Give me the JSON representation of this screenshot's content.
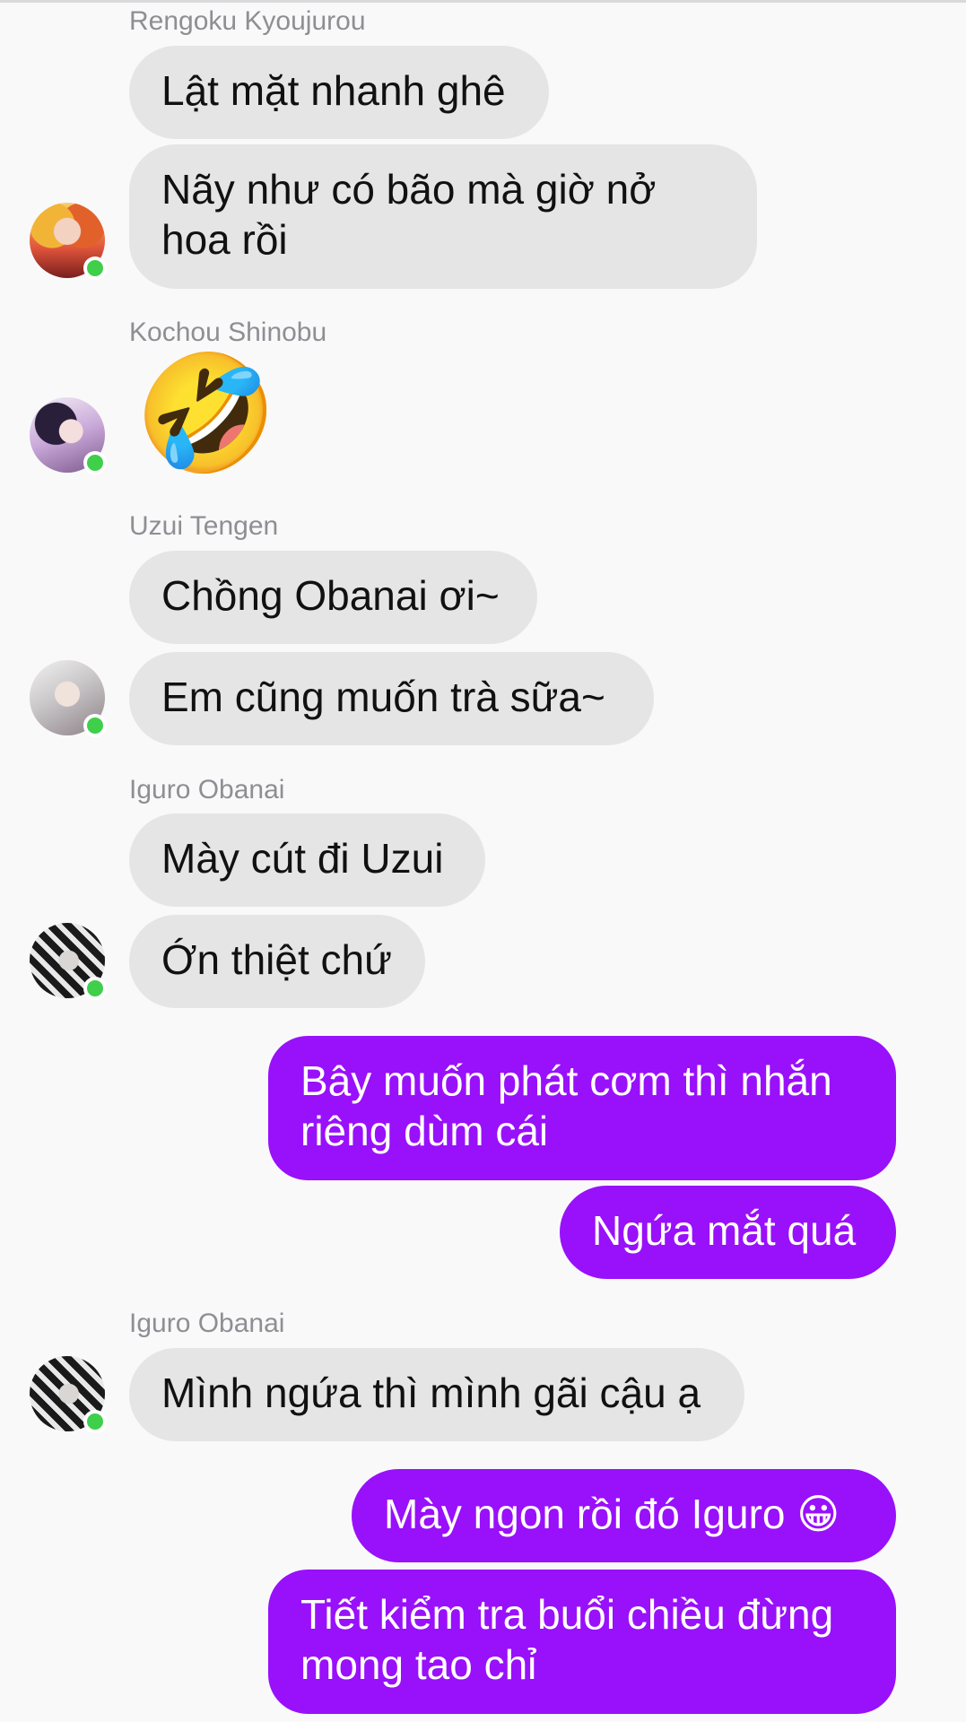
{
  "messages": [
    {
      "sender": "Rengoku Kyoujurou",
      "bubbles": [
        "Lật mặt nhanh ghê",
        "Nãy như có bão mà giờ nở hoa rồi"
      ]
    },
    {
      "sender": "Kochou Shinobu",
      "emoji": "🤣"
    },
    {
      "sender": "Uzui Tengen",
      "bubbles": [
        "Chồng Obanai ơi~",
        "Em cũng muốn trà sữa~"
      ]
    },
    {
      "sender": "Iguro Obanai",
      "bubbles": [
        "Mày cút đi Uzui",
        "Ớn thiệt chứ"
      ]
    },
    {
      "outgoing": [
        "Bây muốn phát cơm thì nhắn riêng dùm cái",
        "Ngứa mắt quá"
      ]
    },
    {
      "sender": "Iguro Obanai",
      "bubbles": [
        "Mình ngứa thì mình gãi cậu ạ"
      ]
    },
    {
      "outgoing": [
        "Mày ngon rồi đó Iguro 😀",
        "Tiết kiểm tra buổi chiều đừng mong tao chỉ"
      ]
    }
  ],
  "colors": {
    "background": "#f9f9fa",
    "incoming_bubble": "#e5e5e5",
    "outgoing_bubble": "#9910fb",
    "online_dot": "#3fcf4a"
  },
  "icons": {
    "avatar_rengoku": "avatar-rengoku",
    "avatar_shinobu": "avatar-shinobu",
    "avatar_uzui": "avatar-uzui",
    "avatar_iguro": "avatar-iguro",
    "online_indicator": "online-dot"
  }
}
